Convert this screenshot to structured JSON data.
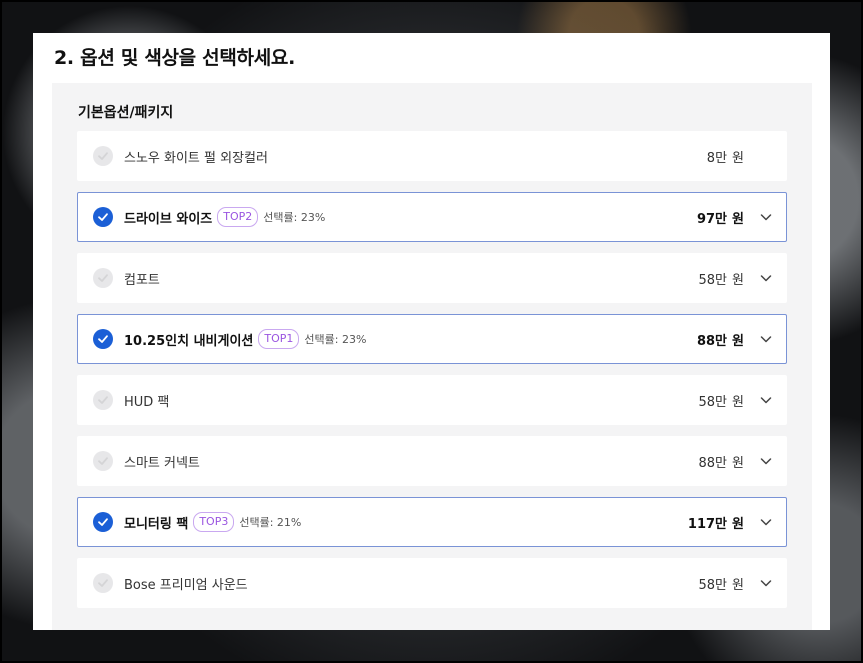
{
  "title": "2. 옵션 및 색상을 선택하세요.",
  "section": {
    "title": "기본옵션/패키지",
    "items": [
      {
        "name": "스노우 화이트 펄 외장컬러",
        "selected": false,
        "badge": "",
        "rate": "",
        "price": "8만",
        "unit": "원",
        "expandable": false
      },
      {
        "name": "드라이브 와이즈",
        "selected": true,
        "badge": "TOP2",
        "rate": "선택률: 23%",
        "price": "97만",
        "unit": "원",
        "expandable": true
      },
      {
        "name": "컴포트",
        "selected": false,
        "badge": "",
        "rate": "",
        "price": "58만",
        "unit": "원",
        "expandable": true
      },
      {
        "name": "10.25인치 내비게이션",
        "selected": true,
        "badge": "TOP1",
        "rate": "선택률: 23%",
        "price": "88만",
        "unit": "원",
        "expandable": true
      },
      {
        "name": "HUD 팩",
        "selected": false,
        "badge": "",
        "rate": "",
        "price": "58만",
        "unit": "원",
        "expandable": true
      },
      {
        "name": "스마트 커넥트",
        "selected": false,
        "badge": "",
        "rate": "",
        "price": "88만",
        "unit": "원",
        "expandable": true
      },
      {
        "name": "모니터링 팩",
        "selected": true,
        "badge": "TOP3",
        "rate": "선택률: 21%",
        "price": "117만",
        "unit": "원",
        "expandable": true
      },
      {
        "name": "Bose 프리미엄 사운드",
        "selected": false,
        "badge": "",
        "rate": "",
        "price": "58만",
        "unit": "원",
        "expandable": true
      }
    ]
  },
  "colors": {
    "accent": "#1b5fd6",
    "badge": "#9a55e0",
    "selected_border": "#7a93d6"
  },
  "icons": {
    "check": "check-icon",
    "chevron": "chevron-down-icon"
  }
}
